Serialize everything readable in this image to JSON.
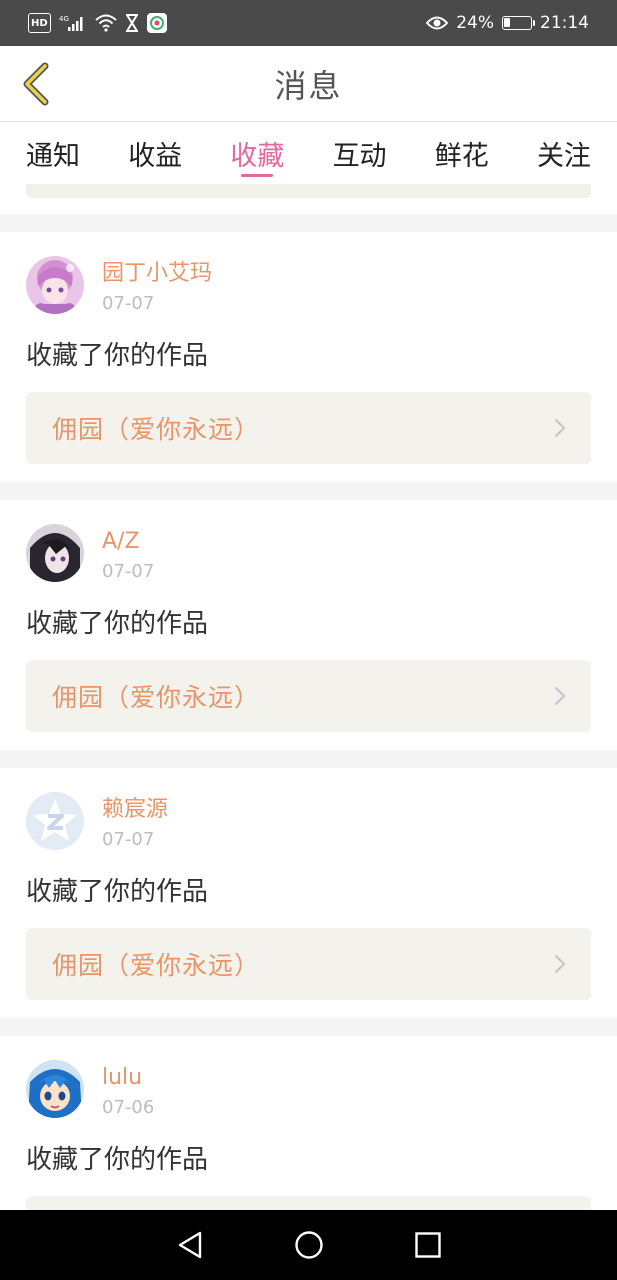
{
  "status_bar": {
    "network": "4G",
    "battery_percent": "24%",
    "battery_level": 0.24,
    "time": "21:14",
    "icons": [
      "hd-icon",
      "signal-icon",
      "wifi-icon",
      "hourglass-icon",
      "app-notification-icon",
      "eye-icon",
      "battery-icon"
    ]
  },
  "header": {
    "title": "消息",
    "back_icon": "chevron-left-icon"
  },
  "tabs": [
    {
      "label": "通知",
      "active": false
    },
    {
      "label": "收益",
      "active": false
    },
    {
      "label": "收藏",
      "active": true
    },
    {
      "label": "互动",
      "active": false
    },
    {
      "label": "鲜花",
      "active": false
    },
    {
      "label": "关注",
      "active": false
    }
  ],
  "messages": [
    {
      "user": "园丁小艾玛",
      "date": "07-07",
      "action": "收藏了你的作品",
      "work": "佣园（爱你永远）",
      "avatar": "anime-girl-pink"
    },
    {
      "user": "A/Z",
      "date": "07-07",
      "action": "收藏了你的作品",
      "work": "佣园（爱你永远）",
      "avatar": "anime-dark-hair"
    },
    {
      "user": "赖宸源",
      "date": "07-07",
      "action": "收藏了你的作品",
      "work": "佣园（爱你永远）",
      "avatar": "default-star-z"
    },
    {
      "user": "lulu",
      "date": "07-06",
      "action": "收藏了你的作品",
      "work": "",
      "avatar": "anime-blue-hair"
    }
  ],
  "nav_bar": {
    "icons": [
      "back-triangle-icon",
      "home-circle-icon",
      "recents-square-icon"
    ]
  },
  "colors": {
    "accent_pink": "#e06a9c",
    "name_orange": "#e9956a",
    "work_bg": "#f3f2ec",
    "status_bar_bg": "#4a4a4a",
    "back_icon_yellow": "#e8d24a"
  }
}
